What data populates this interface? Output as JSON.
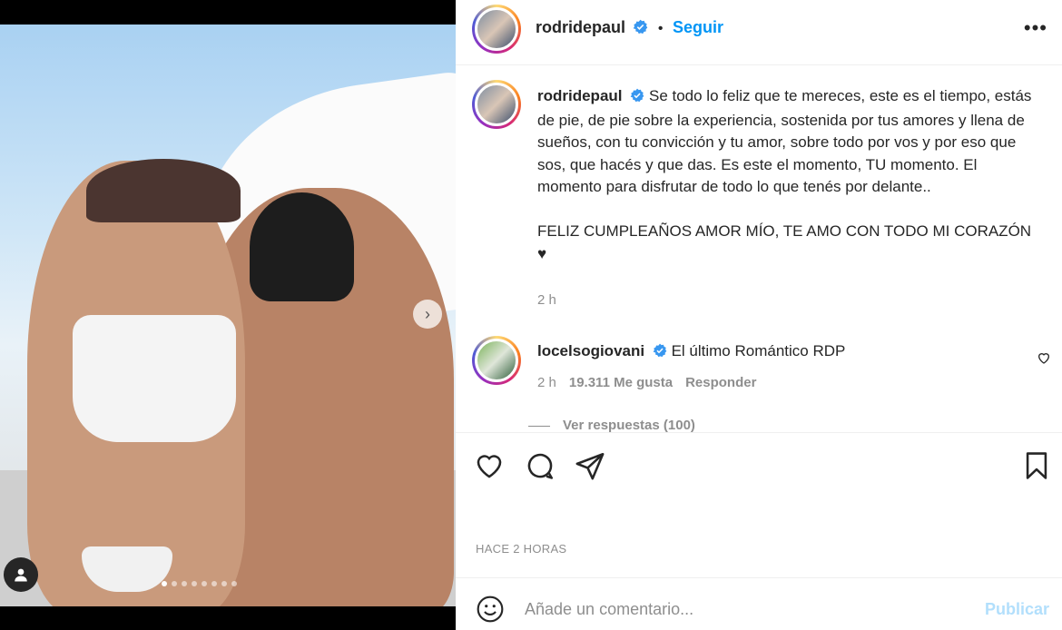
{
  "post": {
    "author": {
      "username": "rodridepaul",
      "verified": true,
      "follow_label": "Seguir",
      "more_icon": "more-horizontal-icon"
    },
    "media": {
      "carousel_dots": 8,
      "active_dot": 1,
      "next_icon": "chevron-right-icon",
      "tag_icon": "user-tag-icon"
    },
    "caption": {
      "username": "rodridepaul",
      "text": "Se todo lo feliz que te mereces, este es el tiempo, estás de pie, de pie sobre la experiencia, sostenida por tus amores y llena de sueños, con tu convicción y tu amor, sobre todo por vos y por eso que sos, que hacés y que das. Es este el momento, TU momento. El momento para disfrutar de todo lo que tenés por delante..",
      "text2": "FELIZ CUMPLEAÑOS AMOR MÍO, TE AMO CON TODO MI CORAZÓN ♥",
      "time": "2 h"
    },
    "comments": [
      {
        "username": "locelsogiovani",
        "verified": true,
        "text": "El último Romántico RDP",
        "time": "2 h",
        "likes": "19.311 Me gusta",
        "reply_label": "Responder",
        "view_replies": "Ver respuestas (100)"
      }
    ],
    "actions": {
      "like_icon": "heart-icon",
      "comment_icon": "comment-icon",
      "share_icon": "send-icon",
      "save_icon": "bookmark-icon"
    },
    "timestamp": "HACE 2 HORAS",
    "add_comment": {
      "placeholder": "Añade un comentario...",
      "publish_label": "Publicar",
      "emoji_icon": "emoji-icon"
    },
    "colors": {
      "link": "#0095f6",
      "publish_disabled": "#b2dffc",
      "muted": "#8e8e8e",
      "text": "#262626"
    }
  }
}
